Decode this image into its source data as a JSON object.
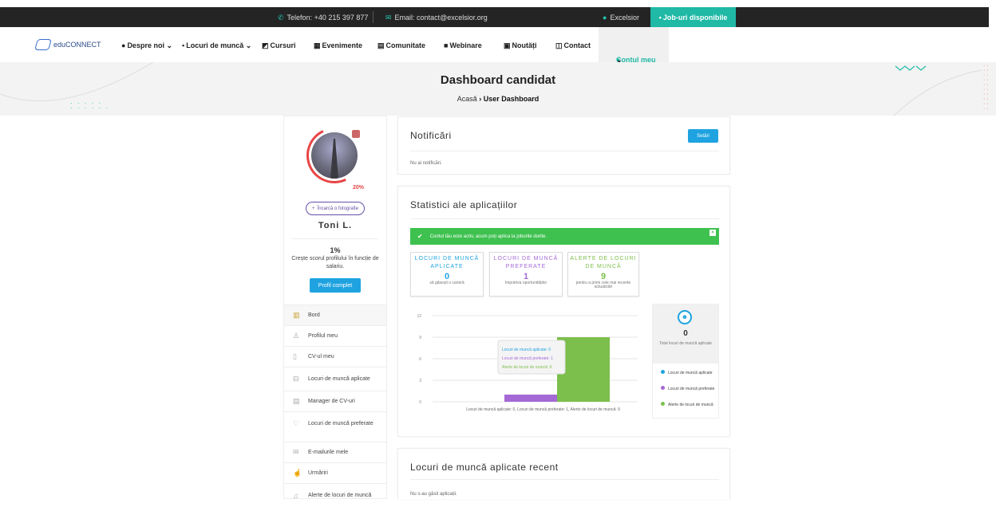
{
  "topbar": {
    "phone": "Telefon: +40 215 397 877",
    "email": "Email: contact@excelsior.org",
    "user": "Excelsior",
    "jobs_button": "Job-uri disponibile"
  },
  "nav": {
    "logo": "eduCONNECT",
    "items": [
      "Despre noi",
      "Locuri de muncă",
      "Cursuri",
      "Evenimente",
      "Comunitate",
      "Webinare",
      "Noutăți",
      "Contact"
    ],
    "active": "Contul meu"
  },
  "hero": {
    "title": "Dashboard candidat",
    "crumb_home": "Acasă",
    "crumb_current": "User Dashboard"
  },
  "sidebar": {
    "progress_pct": "20%",
    "upload_label": "Încarcă o fotografie",
    "name": "Toni L.",
    "score": "1%",
    "score_text": "Crește scorul profilului în funcție de salariu.",
    "profile_button": "Profil complet",
    "menu": [
      "Bord",
      "Profilul meu",
      "CV-ul meu",
      "Locuri de muncă aplicate",
      "Manager de CV-uri",
      "Locuri de muncă preferate",
      "E-mailurile mele",
      "Urmăriri",
      "Alerte de locuri de muncă"
    ]
  },
  "notifications": {
    "title": "Notificări",
    "button": "Setări",
    "empty": "Nu ai notificări."
  },
  "stats": {
    "title": "Statistici ale aplicațiilor",
    "alert": "Contul tău este activ, acum poți aplica la joburile dorite.",
    "boxes": [
      {
        "title": "LOCURI DE MUNCĂ APLICATE",
        "value": "0",
        "sub": "să găsești o carieră",
        "color": "#1fa3e0"
      },
      {
        "title": "LOCURI DE MUNCĂ PREFERATE",
        "value": "1",
        "sub": "împotriva oportunităților",
        "color": "#a569d6"
      },
      {
        "title": "ALERTE DE LOCURI DE MUNCĂ",
        "value": "9",
        "sub": "pentru a primi cele mai recente actualizări",
        "color": "#7cbf4c"
      }
    ],
    "total_value": "0",
    "total_label": "Total locuri de muncă aplicate",
    "legend": [
      "Locuri de muncă aplicate",
      "Locuri de muncă preferate",
      "Alerte de locuri de muncă"
    ]
  },
  "chart_data": {
    "type": "bar",
    "categories": [
      "Locuri de muncă aplicate",
      "Locuri de muncă preferate",
      "Alerte de locuri de muncă"
    ],
    "values": [
      0,
      1,
      9
    ],
    "colors": [
      "#1fa3e0",
      "#a569d6",
      "#7cbf4c"
    ],
    "yticks": [
      "0",
      "3",
      "6",
      "9",
      "12"
    ],
    "ylim": [
      0,
      12
    ],
    "xlabel": "Locuri de muncă aplicate: 0, Locuri de muncă preferate: 1, Alerte de locuri de muncă: 9",
    "tooltip": [
      "Locuri de muncă aplicate: 0",
      "Locuri de muncă preferate: 1",
      "Alerte de locuri de muncă: 9"
    ]
  },
  "recent": {
    "title": "Locuri de muncă aplicate recent",
    "empty": "Nu s-au găsit aplicații."
  }
}
